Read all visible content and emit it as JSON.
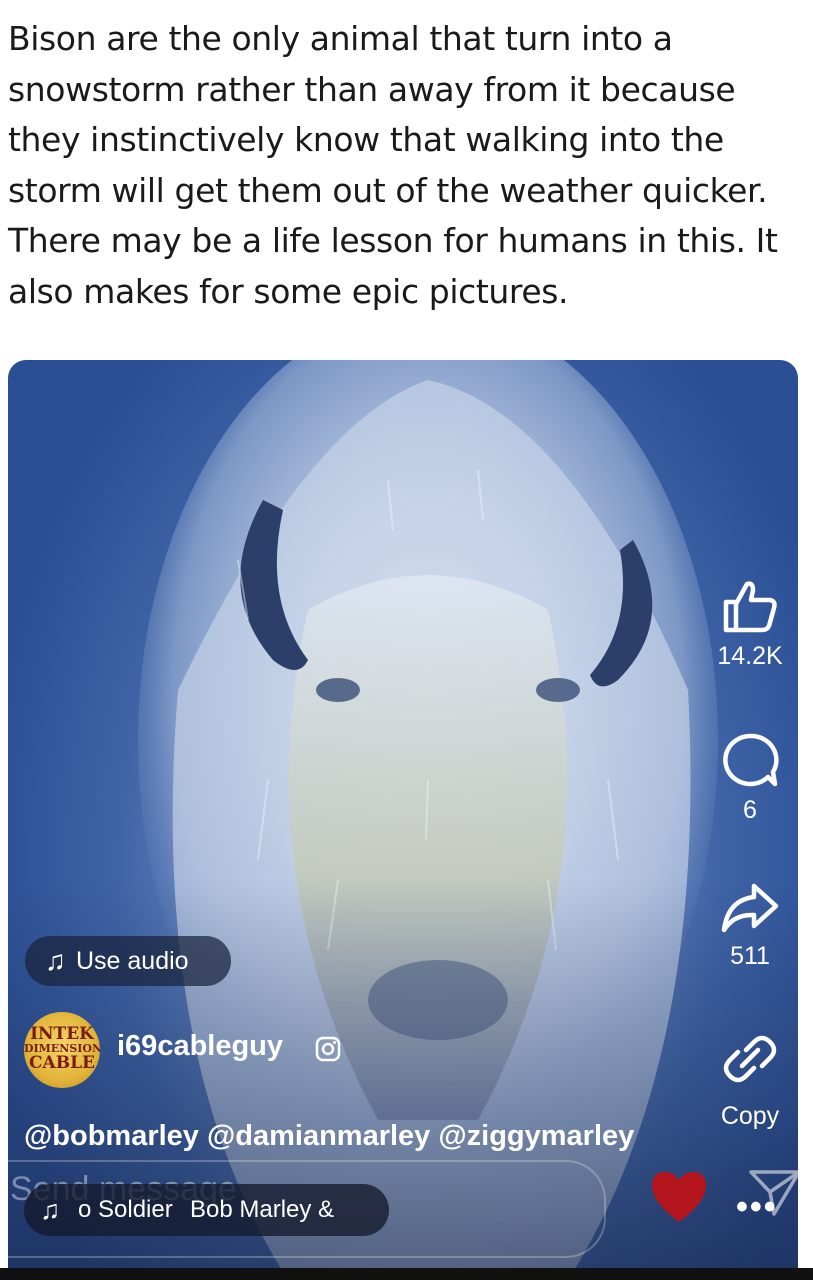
{
  "post": {
    "caption": "Bison are the only animal that turn into a snowstorm rather than away from it because they instinctively know that walking into the storm will get them out of the weather quicker. There may be a life lesson for humans in this. It also makes for some epic pictures."
  },
  "reel": {
    "image_description_icon": "bison-in-snow",
    "actions": {
      "likes": "14.2K",
      "comments": "6",
      "shares": "511",
      "copy_label": "Copy"
    },
    "use_audio_label": "Use audio",
    "author": {
      "avatar_lines": [
        "INTEK",
        "DIMENSION",
        "CABLE"
      ],
      "username": "i69cableguy"
    },
    "mentions": "@bobmarley @damianmarley @ziggymarley",
    "send_placeholder": "Send message",
    "music": {
      "song": "o Soldier",
      "artist": "Bob Marley &"
    },
    "more_label": "•••"
  },
  "colors": {
    "reel_blue": "#3e63a6",
    "heart_red": "#b3161d",
    "text_dark": "#1a1a1a"
  }
}
